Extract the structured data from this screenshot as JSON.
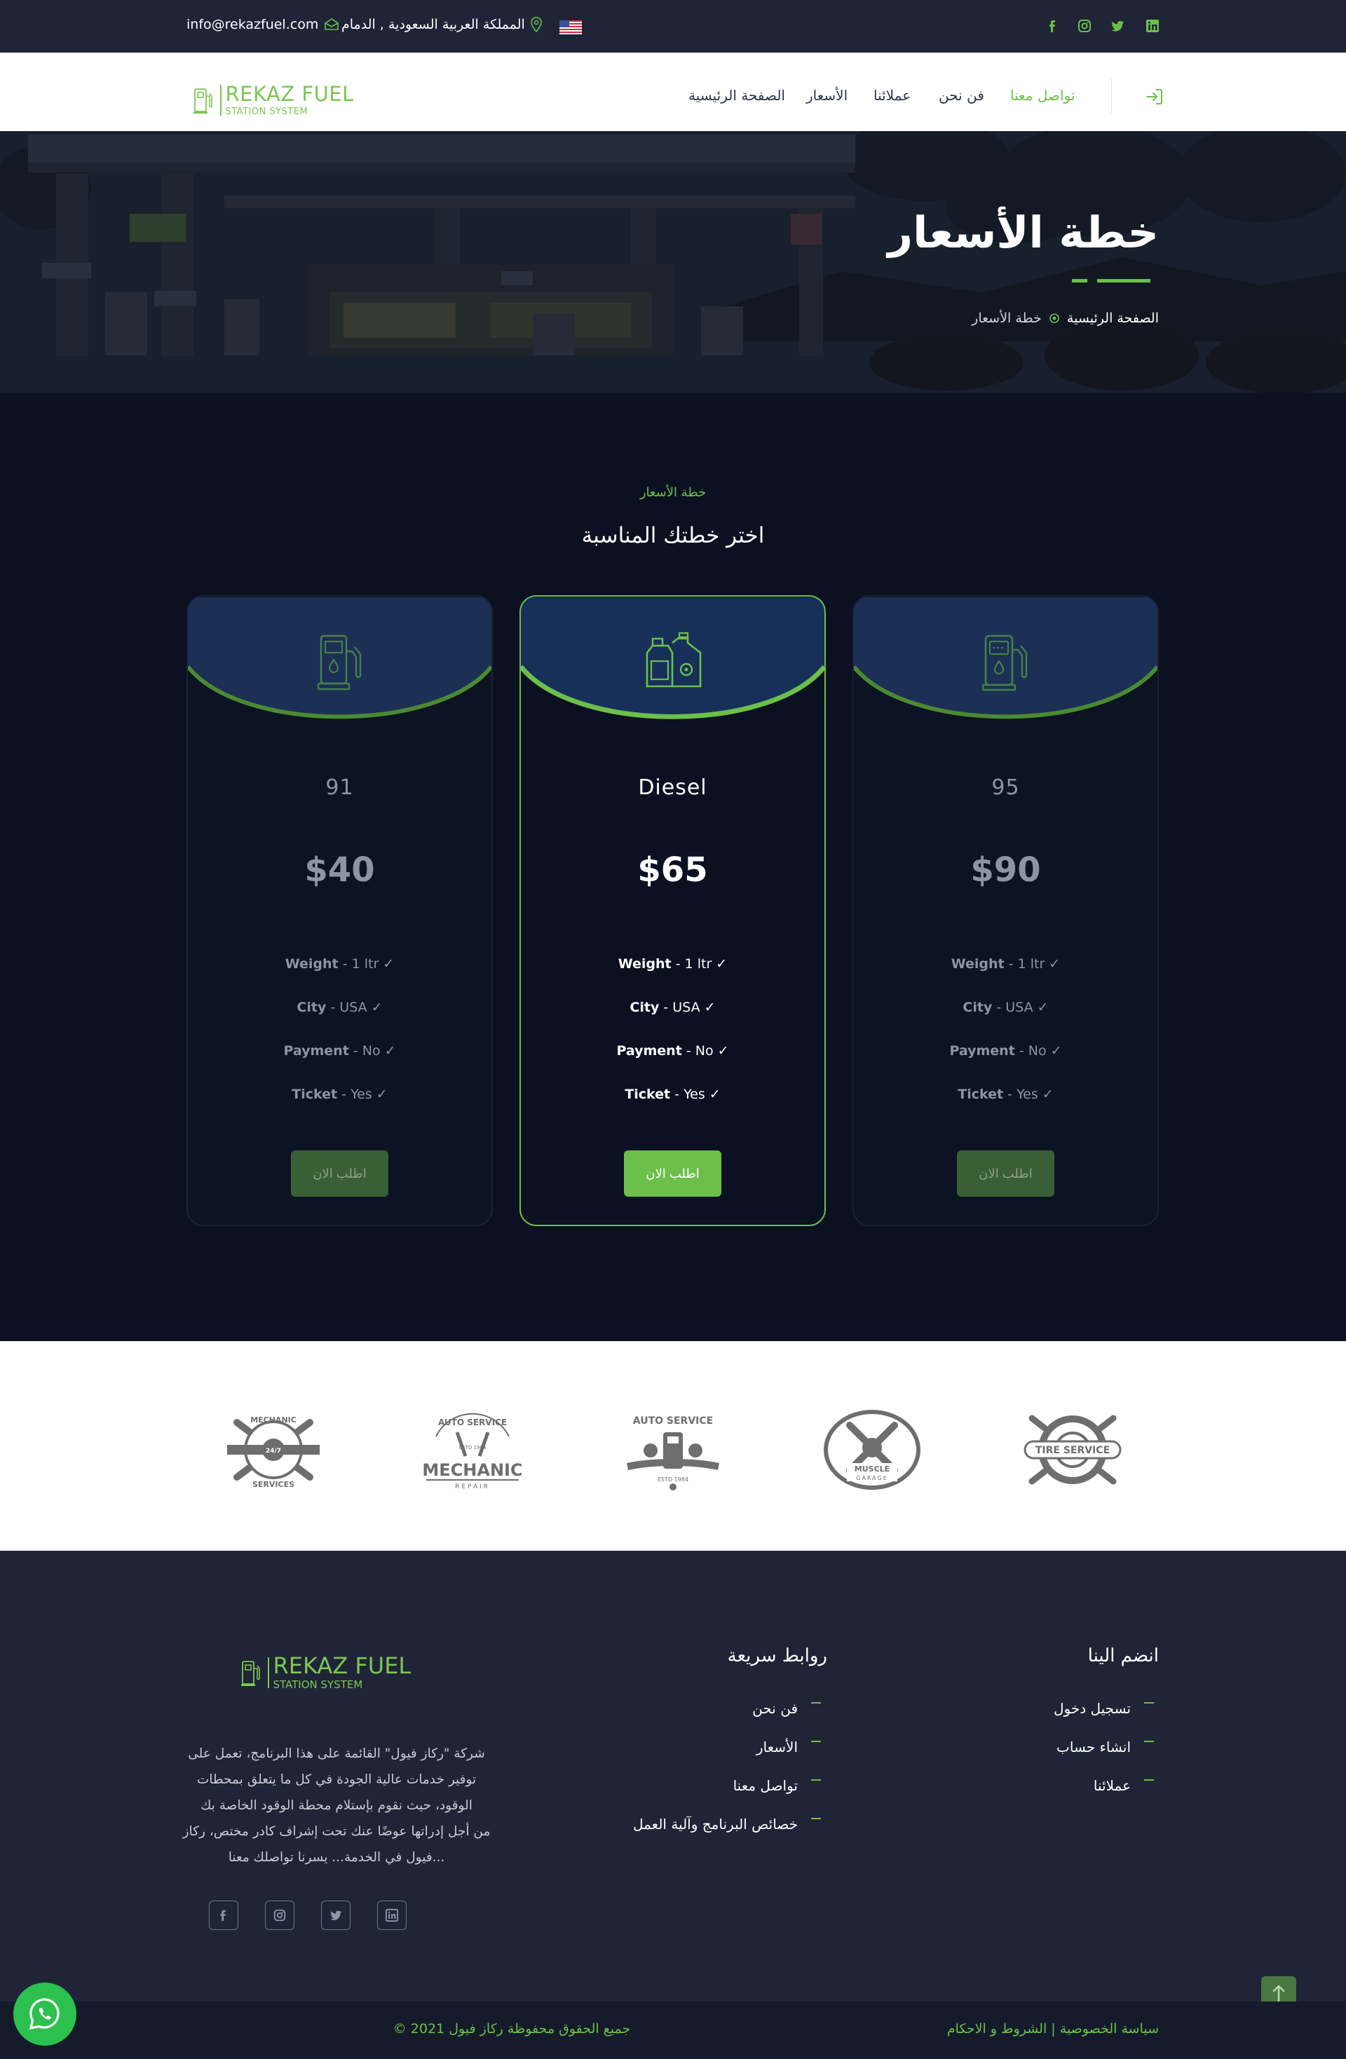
{
  "topbar": {
    "email": "info@rekazfuel.com",
    "address": "المملكة العربية السعودية , الدمام",
    "flag": "us-flag",
    "socials": [
      "facebook-icon",
      "instagram-icon",
      "twitter-icon",
      "linkedin-icon"
    ]
  },
  "brand": {
    "name": "REKAZ FUEL",
    "tagline": "STATION SYSTEM"
  },
  "nav": {
    "items": [
      "تواصل معنا",
      "فن نحن",
      "عملائنا",
      "الأسعار",
      "الصفحة الرئيسية"
    ],
    "active": "تواصل معنا",
    "login_icon": "sign-in-icon"
  },
  "hero": {
    "title": "خطة الأسعار",
    "breadcrumb_home": "الصفحة الرئيسية",
    "breadcrumb_current": "خطة الأسعار"
  },
  "pricing": {
    "eyebrow": "خطة الأسعار",
    "heading": "اختر خطتك المناسبة",
    "plans": [
      {
        "name": "91",
        "price": "$40",
        "icon": "fuel-pump-icon",
        "features": [
          [
            "Weight",
            "- 1 ltr"
          ],
          [
            "City",
            "- USA"
          ],
          [
            "Payment",
            "- No"
          ],
          [
            "Ticket",
            "- Yes"
          ]
        ],
        "button": "اطلب الان"
      },
      {
        "name": "Diesel",
        "price": "$65",
        "icon": "oil-canister-icon",
        "features": [
          [
            "Weight",
            "- 1 ltr"
          ],
          [
            "City",
            "- USA"
          ],
          [
            "Payment",
            "- No"
          ],
          [
            "Ticket",
            "- Yes"
          ]
        ],
        "button": "اطلب الان"
      },
      {
        "name": "95",
        "price": "$90",
        "icon": "gas-station-icon",
        "features": [
          [
            "Weight",
            "- 1 ltr"
          ],
          [
            "City",
            "- USA"
          ],
          [
            "Payment",
            "- No"
          ],
          [
            "Ticket",
            "- Yes"
          ]
        ],
        "button": "اطلب الان"
      }
    ]
  },
  "brands": [
    {
      "name": "mechanic-services-logo",
      "lines": [
        "MECHANIC",
        "24/7",
        "SERVICES"
      ]
    },
    {
      "name": "mechanic-repair-logo",
      "lines": [
        "AUTO SERVICE",
        "ESTD 1984",
        "MECHANIC",
        "REPAIR"
      ]
    },
    {
      "name": "auto-service-logo",
      "lines": [
        "AUTO SERVICE",
        "ESTD 1984"
      ]
    },
    {
      "name": "muscle-garage-logo",
      "lines": [
        "MUSCLE",
        "GARAGE"
      ]
    },
    {
      "name": "tire-service-logo",
      "lines": [
        "TIRE SERVICE"
      ]
    }
  ],
  "footer": {
    "about": "شركة \"ركاز فيول\" القائمة على هذا البرنامج، تعمل على توفير خدمات عالية الجودة في كل ما يتعلق بمحطات الوقود، حيث نقوم بإستلام محطة الوقود الخاصة بك من أجل إدراتها عوضًا عنك تحت إشراف كادر مختص، ركاز فيول في الخدمة... يسرنا تواصلك معنا...",
    "about_lines": [
      "شركة \"ركاز فيول\" القائمة على هذا البرنامج، تعمل على",
      "توفير خدمات عالية الجودة في كل ما يتعلق بمحطات",
      "الوقود، حيث نقوم بإستلام محطة الوقود الخاصة بك",
      "من أجل إدراتها عوضًا عنك تحت إشراف كادر مختص، ركاز",
      "فيول في الخدمة... يسرنا تواصلك معنا..."
    ],
    "quick_title": "روابط سريعة",
    "quick_links": [
      "فن نحن",
      "الأسعار",
      "تواصل معنا",
      "خصائص البرنامج وآلية العمل"
    ],
    "join_title": "انضم الينا",
    "join_links": [
      "تسجيل دخول",
      "انشاء حساب",
      "عملائنا"
    ],
    "socials": [
      "facebook-icon",
      "instagram-icon",
      "twitter-icon",
      "linkedin-icon"
    ]
  },
  "copyright": {
    "text": "© 2021 جميع الحقوق محفوظة ركاز فيول",
    "links": "سياسة الخصوصية | الشروط و الاحكام"
  },
  "colors": {
    "accent": "#6cc04a",
    "dark": "#1f2537",
    "page": "#0b1120"
  }
}
